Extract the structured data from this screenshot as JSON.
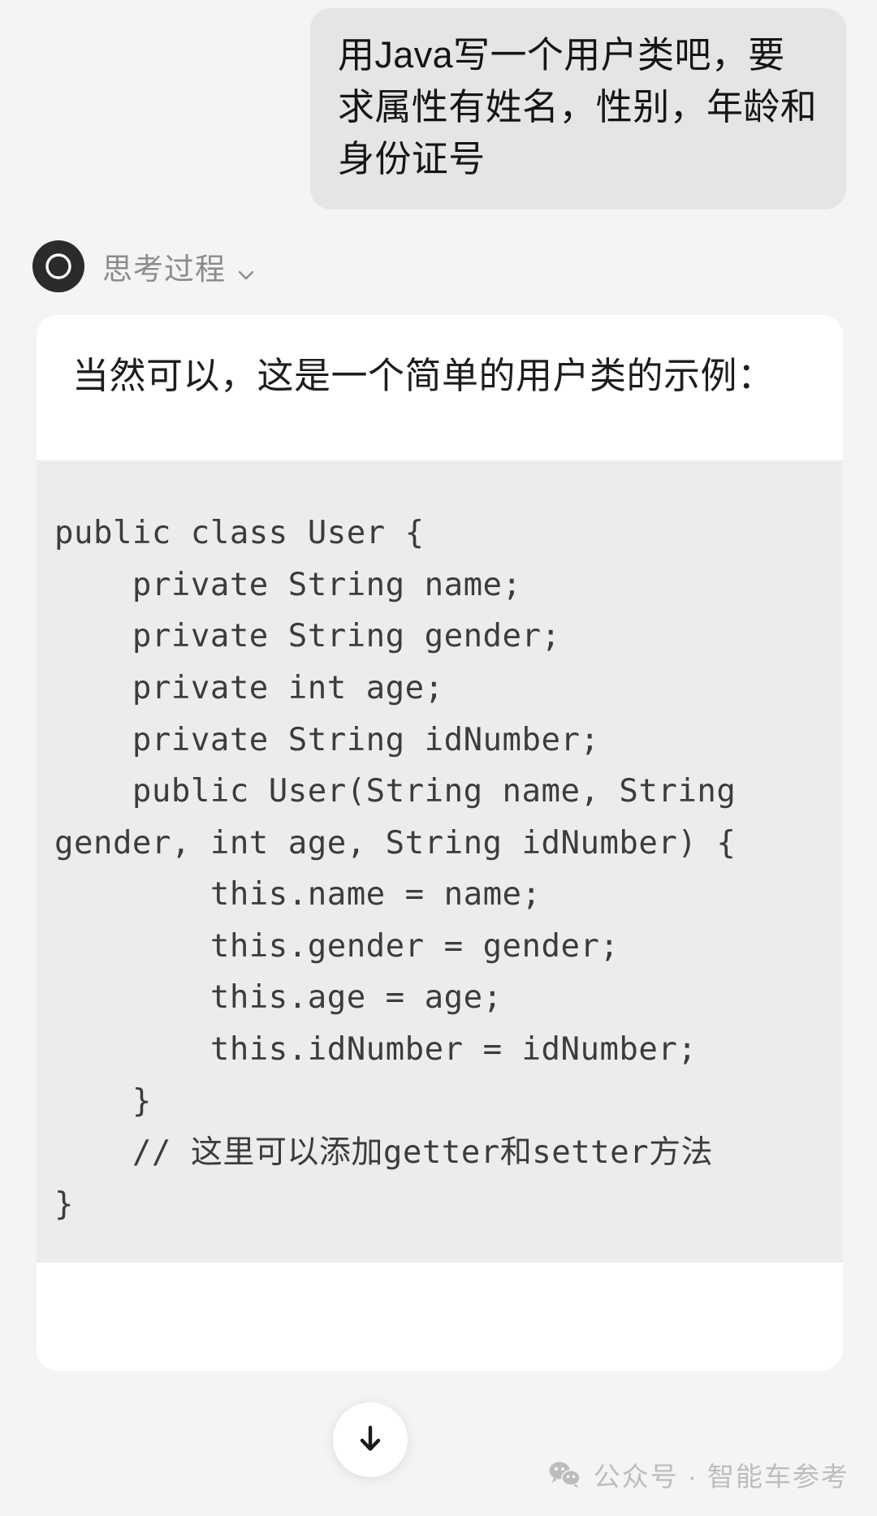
{
  "theme": {
    "page_bg": "#f4f4f4",
    "user_bubble_bg": "#e5e5e5",
    "card_bg": "#ffffff",
    "code_bg": "#ececec",
    "avatar_bg": "#2b2b2b",
    "text_color": "#1d1d1d",
    "muted_color": "#8c8c8c",
    "code_text_color": "#3c3c3c",
    "watermark_color": "#bdbdbd"
  },
  "conversation": {
    "user_message": {
      "text": "用Java写一个用户类吧，要求属性有姓名，性别，年龄和身份证号",
      "role": "user"
    },
    "assistant": {
      "avatar_icon": "robot-face-icon",
      "thinking_label": "思考过程",
      "thinking_chevron_icon": "chevron-down-icon",
      "answer_text": "当然可以，这是一个简单的用户类的示例：",
      "code": {
        "language": "java",
        "lines": [
          "public class User {",
          "    private String name;",
          "    private String gender;",
          "    private int age;",
          "    private String idNumber;",
          "    public User(String name, String gender, int age, String idNumber) {",
          "        this.name = name;",
          "        this.gender = gender;",
          "        this.age = age;",
          "        this.idNumber = idNumber;",
          "    }",
          "    // 这里可以添加getter和setter方法",
          "}"
        ],
        "text": "public class User {\n    private String name;\n    private String gender;\n    private int age;\n    private String idNumber;\n    public User(String name, String gender, int age, String idNumber) {\n        this.name = name;\n        this.gender = gender;\n        this.age = age;\n        this.idNumber = idNumber;\n    }\n    // 这里可以添加getter和setter方法\n}"
      }
    }
  },
  "scroll_button": {
    "icon": "arrow-down-icon",
    "label": ""
  },
  "watermark": {
    "icon": "wechat-icon",
    "text": "公众号 · 智能车参考"
  }
}
